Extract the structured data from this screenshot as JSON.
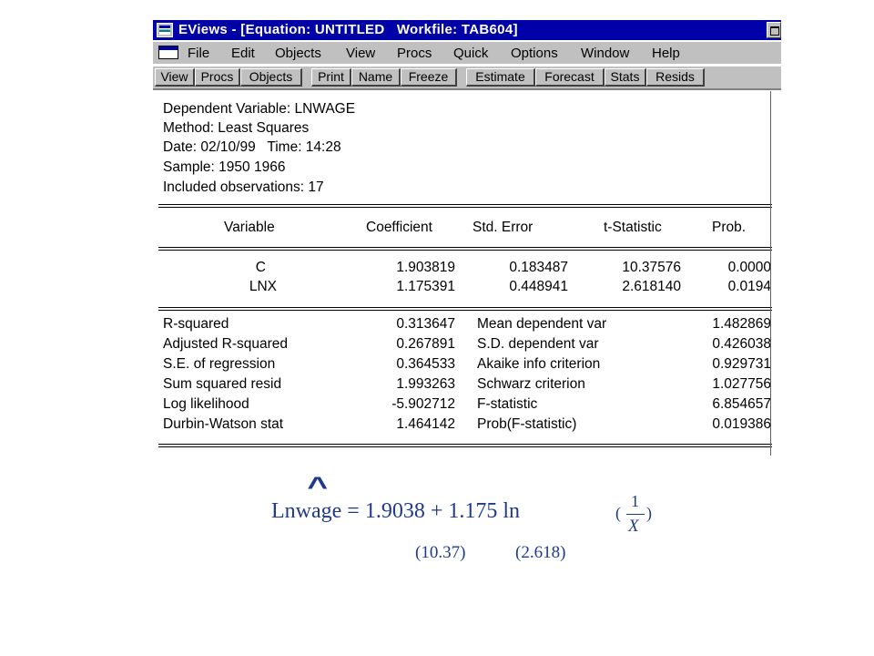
{
  "window": {
    "title": "EViews - [Equation: UNTITLED   Workfile: TAB604]"
  },
  "menu": [
    "File",
    "Edit",
    "Objects",
    "View",
    "Procs",
    "Quick",
    "Options",
    "Window",
    "Help"
  ],
  "toolbar": [
    "View",
    "Procs",
    "Objects",
    "Print",
    "Name",
    "Freeze",
    "Estimate",
    "Forecast",
    "Stats",
    "Resids"
  ],
  "header": {
    "dependent": "Dependent Variable: LNWAGE",
    "method": "Method: Least Squares",
    "date": "Date: 02/10/99   Time: 14:28",
    "sample": "Sample: 1950 1966",
    "observations": "Included observations: 17"
  },
  "coef_table": {
    "columns": [
      "Variable",
      "Coefficient",
      "Std. Error",
      "t-Statistic",
      "Prob."
    ],
    "rows": [
      [
        "C",
        "1.903819",
        "0.183487",
        "10.37576",
        "0.0000"
      ],
      [
        "LNX",
        "1.175391",
        "0.448941",
        "2.618140",
        "0.0194"
      ]
    ]
  },
  "stats": [
    [
      "R-squared",
      "0.313647",
      "Mean dependent var",
      "1.482869"
    ],
    [
      "Adjusted R-squared",
      "0.267891",
      "S.D. dependent var",
      "0.426038"
    ],
    [
      "S.E. of regression",
      "0.364533",
      "Akaike info criterion",
      "0.929731"
    ],
    [
      "Sum squared resid",
      "1.993263",
      "Schwarz criterion",
      "1.027756"
    ],
    [
      "Log likelihood",
      "-5.902712",
      "F-statistic",
      "6.854657"
    ],
    [
      "Durbin-Watson stat",
      "1.464142",
      "Prob(F-statistic)",
      "0.019386"
    ]
  ],
  "equation": {
    "hat": "^",
    "text": "Lnwage = 1.9038 + 1.175 ln",
    "paren_open": "(",
    "numerator": "1",
    "denominator": "X",
    "paren_close": ")",
    "t_values": [
      "(10.37)",
      "(2.618)"
    ]
  },
  "colors": {
    "titlebar": "#0000a8",
    "chrome": "#c0c0c0",
    "equation_text": "#1f3a8a"
  }
}
